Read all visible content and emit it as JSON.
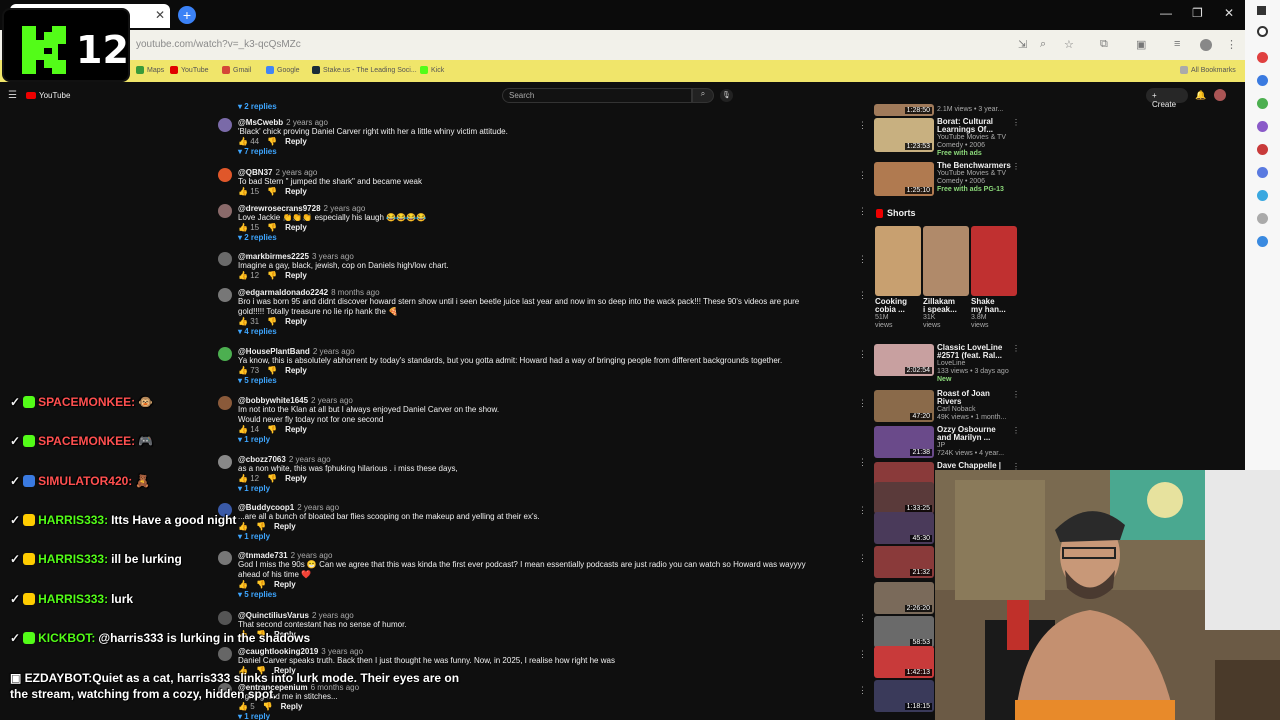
{
  "browser": {
    "url": "youtube.com/watch?v=_k3-qcQsMZc",
    "tab_close": "✕",
    "new_tab": "+",
    "window_controls": [
      "—",
      "❐",
      "✕"
    ],
    "bookmarks": [
      {
        "label": "Maps",
        "color": "#3a9b3a"
      },
      {
        "label": "YouTube",
        "color": "#e00000"
      },
      {
        "label": "Gmail",
        "color": "#d44638"
      },
      {
        "label": "Google",
        "color": "#4285f4"
      },
      {
        "label": "Stake.us - The Leading Soci...",
        "color": "#1a2c38"
      },
      {
        "label": "Kick",
        "color": "#53fc18"
      }
    ],
    "all_bookmarks": "All Bookmarks"
  },
  "overlay": {
    "k12_number": "12",
    "k12_color": "#53fc18"
  },
  "youtube": {
    "logo": "YouTube",
    "search_placeholder": "Search",
    "create_label": "+ Create"
  },
  "comments": [
    {
      "replies_only": true,
      "replies": "▾ 2 replies",
      "y": 0
    },
    {
      "handle": "@MsCwebb",
      "time": "2 years ago",
      "text": "'Black' chick proving Daniel Carver right with her a little whiny victim attitude.",
      "likes": "44",
      "replies": "▾ 7 replies",
      "avatar": "#7a6aa8"
    },
    {
      "handle": "@QBN37",
      "time": "2 years ago",
      "text": "To bad Stern \" jumped the shark\" and became weak",
      "likes": "15",
      "replies": "",
      "avatar": "#e0572a"
    },
    {
      "handle": "@drewrosecrans9728",
      "time": "2 years ago",
      "text": "Love Jackie 👏👏👏 especially his laugh 😂😂😂😂",
      "likes": "15",
      "replies": "▾ 2 replies",
      "avatar": "#8a6a6a"
    },
    {
      "handle": "@markbirmes2225",
      "time": "3 years ago",
      "text": "Imagine a gay, black, jewish, cop on Daniels high/low chart.",
      "likes": "12",
      "replies": "",
      "avatar": "#6a6a6a"
    },
    {
      "handle": "@edgarmaldonado2242",
      "time": "8 months ago",
      "text": "Bro i was born 95 and didnt discover howard stern show until i seen beetle juice last year and now im so deep into the wack pack!!! These 90's videos are pure",
      "text2": "gold!!!!! Totally treasure no lie rip hank the 🍕",
      "likes": "31",
      "replies": "▾ 4 replies",
      "avatar": "#777"
    },
    {
      "handle": "@HousePlantBand",
      "time": "2 years ago",
      "text": "Ya know, this is absolutely abhorrent by today's standards, but you gotta admit: Howard had a way of bringing people from different backgrounds together.",
      "likes": "73",
      "replies": "▾ 5 replies",
      "avatar": "#4caf50"
    },
    {
      "handle": "@bobbywhite1645",
      "time": "2 years ago",
      "text": "Im not into the Klan at all but I always enjoyed Daniel Carver on the show.",
      "text2": "Would never fly today not for one second",
      "likes": "14",
      "replies": "▾ 1 reply",
      "avatar": "#8a5a3a"
    },
    {
      "handle": "@cbozz7063",
      "time": "2 years ago",
      "text": "as a non white, this was fphuking hilarious . i miss these days,",
      "likes": "12",
      "replies": "▾ 1 reply",
      "avatar": "#888"
    },
    {
      "handle": "@Buddycoop1",
      "time": "2 years ago",
      "text": "...are all a bunch of bloated bar flies scooping on the makeup and yelling at their ex's.",
      "likes": "",
      "replies": "▾ 1 reply",
      "avatar": "#3a5aa8"
    },
    {
      "handle": "@tnmade731",
      "time": "2 years ago",
      "text": "God I miss the 90s 😁 Can we agree that this was kinda the first ever podcast? I mean essentially podcasts are just radio you can watch so Howard was wayyyy",
      "text2": "ahead of his time ❤️",
      "likes": "",
      "replies": "▾ 5 replies",
      "avatar": "#777"
    },
    {
      "handle": "@QuinctiliusVarus",
      "time": "2 years ago",
      "text": "That second contestant has no sense of humor.",
      "likes": "",
      "replies": "",
      "avatar": "#555"
    },
    {
      "handle": "@caughtlooking2019",
      "time": "3 years ago",
      "text": "Daniel Carver speaks truth. Back then I just thought he was funny. Now, in 2025, I realise how right he was",
      "likes": "",
      "replies": "",
      "avatar": "#666"
    },
    {
      "handle": "@entrancepenium",
      "time": "6 months ago",
      "text": "...ghing had me in stitches...",
      "likes": "5",
      "replies": "▾ 1 reply",
      "avatar": "#666"
    }
  ],
  "sidebar": {
    "top_meta": {
      "duration": "1:28:50",
      "meta": "2.1M views • 3 year..."
    },
    "videos": [
      {
        "title": "Borat: Cultural",
        "title2": "Learnings Of...",
        "meta1": "YouTube Movies & TV",
        "meta2": "Comedy • 2006",
        "badge": "Free with ads",
        "duration": "1:23:53",
        "thumb": "#c8b080"
      },
      {
        "title": "The Benchwarmers",
        "title2": "",
        "meta1": "YouTube Movies & TV",
        "meta2": "Comedy • 2006",
        "badge": "Free with ads  PG-13",
        "duration": "1:25:10",
        "thumb": "#b07a50"
      }
    ],
    "shorts_label": "Shorts",
    "shorts": [
      {
        "title": "Cooking",
        "title2": "cobia ...",
        "views": "51M",
        "views2": "views",
        "thumb": "#c8a070"
      },
      {
        "title": "Zillakam",
        "title2": "i speak...",
        "views": "31K",
        "views2": "views",
        "thumb": "#b08a6a"
      },
      {
        "title": "Shake",
        "title2": "my han...",
        "views": "3.8M",
        "views2": "views",
        "thumb": "#c03030"
      }
    ],
    "videos2": [
      {
        "title": "Classic LoveLine",
        "title2": "#2571 (feat. Ral...",
        "meta1": "LoveLine",
        "meta2": "133 views • 3 days ago",
        "badge": "New",
        "duration": "2:02:54",
        "thumb": "#c8a0a0"
      },
      {
        "title": "Roast of Joan",
        "title2": "Rivers",
        "meta1": "Carl Noback",
        "meta2": "49K views • 1 month...",
        "badge": "",
        "duration": "47:20",
        "thumb": "#8a6a4a"
      },
      {
        "title": "Ozzy Osbourne",
        "title2": "and Marilyn ...",
        "meta1": "JP",
        "meta2": "724K views • 4 year...",
        "badge": "",
        "duration": "21:38",
        "thumb": "#6a4a8a"
      },
      {
        "title": "Dave Chappelle |",
        "title2": "",
        "meta1": "",
        "meta2": "",
        "badge": "",
        "duration": "",
        "thumb": "#8a3a3a"
      }
    ],
    "lower_durations": [
      "1:33:25",
      "45:30",
      "21:32",
      "2:26:20",
      "58:53",
      "1:42:13",
      "1:18:15"
    ]
  },
  "chat": [
    {
      "user": "SPACEMONKEE:",
      "msg": "🐵",
      "color": "#ff5050",
      "badge": "#53fc18"
    },
    {
      "user": "SPACEMONKEE:",
      "msg": "🎮",
      "color": "#ff5050",
      "badge": "#53fc18"
    },
    {
      "user": "SIMULATOR420:",
      "msg": "🧸",
      "color": "#ff5050",
      "badge": "#3a7ae0"
    },
    {
      "user": "HARRIS333:",
      "msg": "Itts Have a good night",
      "color": "#53fc18",
      "badge": "#ffcc00"
    },
    {
      "user": "HARRIS333:",
      "msg": "ill be lurking",
      "color": "#53fc18",
      "badge": "#ffcc00"
    },
    {
      "user": "HARRIS333:",
      "msg": "lurk",
      "color": "#53fc18",
      "badge": "#ffcc00"
    },
    {
      "user": "KICKBOT:",
      "msg": "@harris333 is lurking in the shadows",
      "color": "#53fc18",
      "badge": "#53fc18"
    }
  ],
  "chat_last": {
    "user": "EZDAYBOT:",
    "msg": "Quiet as a cat, harris333 slinks into lurk mode. Their eyes are on the stream, watching from a cozy, hidden spot.",
    "color": "#ffffff"
  }
}
